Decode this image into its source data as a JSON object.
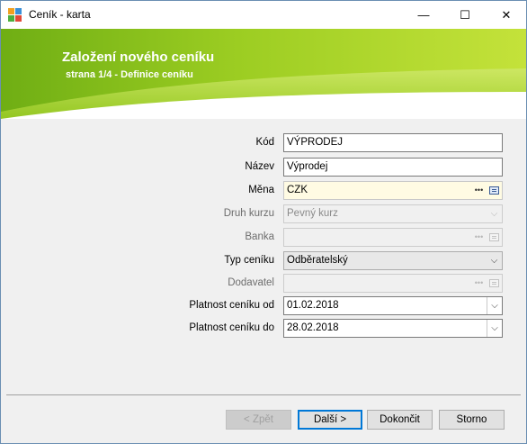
{
  "window": {
    "title": "Ceník - karta",
    "minimize_glyph": "—",
    "maximize_glyph": "☐",
    "close_glyph": "✕"
  },
  "banner": {
    "title": "Založení nového ceníku",
    "subtitle": "strana 1/4 - Definice ceníku",
    "colors": {
      "light_green": "#b8dc2e",
      "mid_green": "#8fc21c",
      "dark_green": "#5a9a10"
    }
  },
  "form": {
    "kod": {
      "label": "Kód",
      "value": "VÝPRODEJ"
    },
    "nazev": {
      "label": "Název",
      "value": "Výprodej"
    },
    "mena": {
      "label": "Měna",
      "value": "CZK",
      "dots": "•••"
    },
    "druh_kurzu": {
      "label": "Druh kurzu",
      "value": "Pevný kurz"
    },
    "banka": {
      "label": "Banka",
      "value": "",
      "dots": "•••"
    },
    "typ_ceniku": {
      "label": "Typ ceníku",
      "value": "Odběratelský"
    },
    "dodavatel": {
      "label": "Dodavatel",
      "value": "",
      "dots": "•••"
    },
    "platnost_od": {
      "label": "Platnost ceníku od",
      "value": "01.02.2018"
    },
    "platnost_do": {
      "label": "Platnost ceníku do",
      "value": "28.02.2018"
    },
    "chevron_glyph": "⌵"
  },
  "footer": {
    "back_label": "< Zpět",
    "next_label": "Další >",
    "finish_label": "Dokončit",
    "cancel_label": "Storno"
  }
}
